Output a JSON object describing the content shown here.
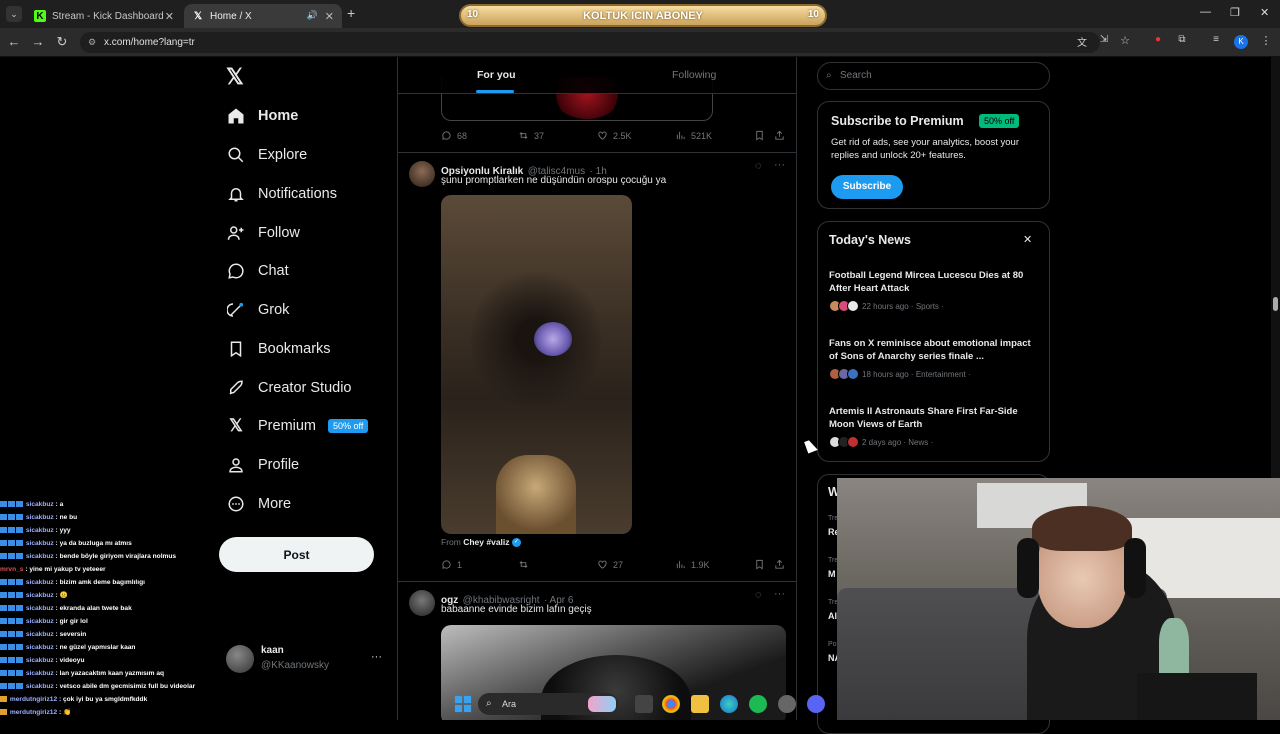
{
  "browser": {
    "tabs": [
      {
        "label": "Stream - Kick Dashboard",
        "icon": "kick-icon",
        "active": false
      },
      {
        "label": "Home / X",
        "icon": "x-icon",
        "active": true
      }
    ],
    "url": "x.com/home?lang=tr",
    "profile_initial": "K"
  },
  "overlay_banner": {
    "text": "KOLTUK ICIN ABONEY",
    "left_count": "10",
    "right_count": "10"
  },
  "nav": {
    "items": [
      {
        "label": "Home",
        "icon": "home-icon"
      },
      {
        "label": "Explore",
        "icon": "search-icon"
      },
      {
        "label": "Notifications",
        "icon": "bell-icon"
      },
      {
        "label": "Follow",
        "icon": "person-add-icon"
      },
      {
        "label": "Chat",
        "icon": "chat-icon"
      },
      {
        "label": "Grok",
        "icon": "grok-icon"
      },
      {
        "label": "Bookmarks",
        "icon": "bookmark-icon"
      },
      {
        "label": "Creator Studio",
        "icon": "rocket-icon"
      },
      {
        "label": "Premium",
        "icon": "x-icon"
      },
      {
        "label": "Profile",
        "icon": "person-icon"
      },
      {
        "label": "More",
        "icon": "more-circle-icon"
      }
    ],
    "premium_badge": "50% off",
    "post_label": "Post"
  },
  "account": {
    "name": "kaan",
    "handle": "@KKaanowsky"
  },
  "timeline": {
    "tabs": [
      {
        "label": "For you",
        "active": true
      },
      {
        "label": "Following",
        "active": false
      }
    ],
    "tweets": [
      {
        "stats": {
          "replies": "68",
          "reposts": "37",
          "likes": "2.5K",
          "views": "521K"
        }
      },
      {
        "name": "Opsiyonlu Kiralık",
        "handle": "@talisc4mus",
        "time": "· 1h",
        "text": "şunu promptlarken ne düşündün orospu çocuğu ya",
        "from_prefix": "From",
        "from_name": "Chey #valiz",
        "stats": {
          "replies": "1",
          "reposts": "",
          "likes": "27",
          "views": "1.9K"
        }
      },
      {
        "name": "ogz",
        "handle": "@khabibwasright",
        "time": "· Apr 6",
        "text": "babaanne evinde bizim lafın geçiş"
      }
    ]
  },
  "right": {
    "search_placeholder": "Search",
    "premium_card": {
      "title": "Subscribe to Premium",
      "badge": "50% off",
      "body": "Get rid of ads, see your analytics, boost your replies and unlock 20+ features.",
      "button": "Subscribe"
    },
    "news": {
      "title": "Today's News",
      "items": [
        {
          "headline": "Football Legend Mircea Lucescu Dies at 80 After Heart Attack",
          "meta": "22 hours ago · Sports ·"
        },
        {
          "headline": "Fans on X reminisce about emotional impact of Sons of Anarchy series finale ...",
          "meta": "18 hours ago · Entertainment ·"
        },
        {
          "headline": "Artemis II Astronauts Share First Far-Side Moon Views of Earth",
          "meta": "2 days ago · News ·"
        }
      ]
    },
    "partial_card_letter": "W",
    "partial_trend_labels": [
      "Tre",
      "Re",
      "Tre",
      "M",
      "Tre",
      "Al",
      "Po",
      "NA"
    ]
  },
  "chat": [
    {
      "user": "sicakbuz",
      "msg": ": a"
    },
    {
      "user": "sicakbuz",
      "msg": ": ne bu"
    },
    {
      "user": "sicakbuz",
      "msg": ": yyy"
    },
    {
      "user": "sicakbuz",
      "msg": ": ya da buzluga mı atmıs"
    },
    {
      "user": "sicakbuz",
      "msg": ": bende böyle giriyom virajlara nolmus"
    },
    {
      "user": "mrvn_s",
      "msg": ": yine mi yakup tv yeteeer",
      "color": "#e05050"
    },
    {
      "user": "sicakbuz",
      "msg": ": bizim amk deme bagımlılıgı"
    },
    {
      "user": "sicakbuz",
      "msg": ": 😐"
    },
    {
      "user": "sicakbuz",
      "msg": ": ekranda alan twete bak"
    },
    {
      "user": "sicakbuz",
      "msg": ": gir gir lol"
    },
    {
      "user": "sicakbuz",
      "msg": ": seversin"
    },
    {
      "user": "sicakbuz",
      "msg": ": ne güzel yapmıslar kaan"
    },
    {
      "user": "sicakbuz",
      "msg": ": videoyu"
    },
    {
      "user": "sicakbuz",
      "msg": ": lan yazacaktım kaan yazmısım aq"
    },
    {
      "user": "sicakbuz",
      "msg": ": vetsco abile dm gecmisimiz full bu videolar"
    },
    {
      "user": "merdutngiriz12",
      "msg": ": çok iyi bu ya smgldmfkddk"
    },
    {
      "user": "merdutngiriz12",
      "msg": ": 👏"
    }
  ],
  "taskbar": {
    "search_label": "Ara"
  },
  "colors": {
    "accent": "#1d9bf0",
    "green_badge": "#00ba7c",
    "border": "#2f3336",
    "muted": "#71767b"
  }
}
